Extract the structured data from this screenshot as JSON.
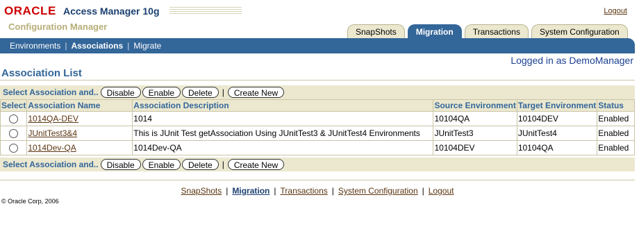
{
  "header": {
    "brand": "ORACLE",
    "product": "Access Manager 10g",
    "subtitle": "Configuration Manager",
    "logout": "Logout",
    "tabs": [
      {
        "label": "SnapShots",
        "active": false
      },
      {
        "label": "Migration",
        "active": true
      },
      {
        "label": "Transactions",
        "active": false
      },
      {
        "label": "System Configuration",
        "active": false
      }
    ],
    "subnav": [
      "Environments",
      "Associations",
      "Migrate"
    ],
    "subnav_active": "Associations",
    "logged_in": "Logged in as DemoManager"
  },
  "main": {
    "title": "Association List",
    "action_label": "Select Association and..",
    "buttons": {
      "disable": "Disable",
      "enable": "Enable",
      "delete": "Delete",
      "create": "Create New"
    },
    "columns": [
      "Select",
      "Association Name",
      "Association Description",
      "Source Environment",
      "Target Environment",
      "Status"
    ],
    "rows": [
      {
        "name": "1014QA-DEV",
        "description": "1014",
        "source": "10104QA",
        "target": "10104DEV",
        "status": "Enabled"
      },
      {
        "name": "JUnitTest3&4",
        "description": "This is JUnit Test getAssociation Using JUnitTest3 & JUnitTest4 Environments",
        "source": "JUnitTest3",
        "target": "JUnitTest4",
        "status": "Enabled"
      },
      {
        "name": "1014Dev-QA",
        "description": "1014Dev-QA",
        "source": "10104DEV",
        "target": "10104QA",
        "status": "Enabled"
      }
    ]
  },
  "footer": {
    "links": [
      "SnapShots",
      "Migration",
      "Transactions",
      "System Configuration",
      "Logout"
    ],
    "current": "Migration",
    "copyright": "© Oracle Corp, 2006"
  },
  "colors": {
    "accent": "#336699",
    "tan": "#ebe8cf",
    "brand_red": "#cc0000",
    "link": "#5b3510"
  }
}
